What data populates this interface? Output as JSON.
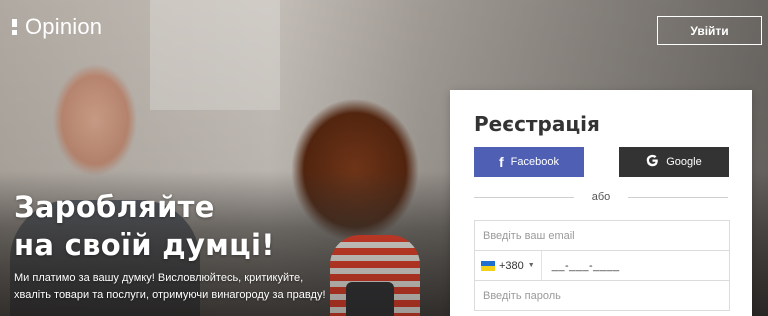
{
  "header": {
    "logo_text": "Opinion",
    "login_label": "Увійти"
  },
  "hero": {
    "headline_line1": "Заробляйте",
    "headline_line2": "на своїй думці!",
    "subtext_line1": "Ми платимо за вашу думку! Висловлюйтесь, критикуйте,",
    "subtext_line2": "хваліть товари та послуги, отримуючи винагороду за правду!"
  },
  "registration": {
    "title": "Реєстрація",
    "facebook_label": "Facebook",
    "google_label": "Google",
    "divider_text": "або",
    "email_placeholder": "Введіть ваш email",
    "phone_code": "+380",
    "phone_mask": "__-___-____",
    "password_placeholder": "Введіть пароль"
  },
  "colors": {
    "facebook": "#4f5fb3",
    "google": "#333333",
    "card_bg": "#ffffff"
  },
  "icons": {
    "facebook": "facebook-icon",
    "google": "google-icon",
    "flag": "ukraine-flag-icon"
  }
}
